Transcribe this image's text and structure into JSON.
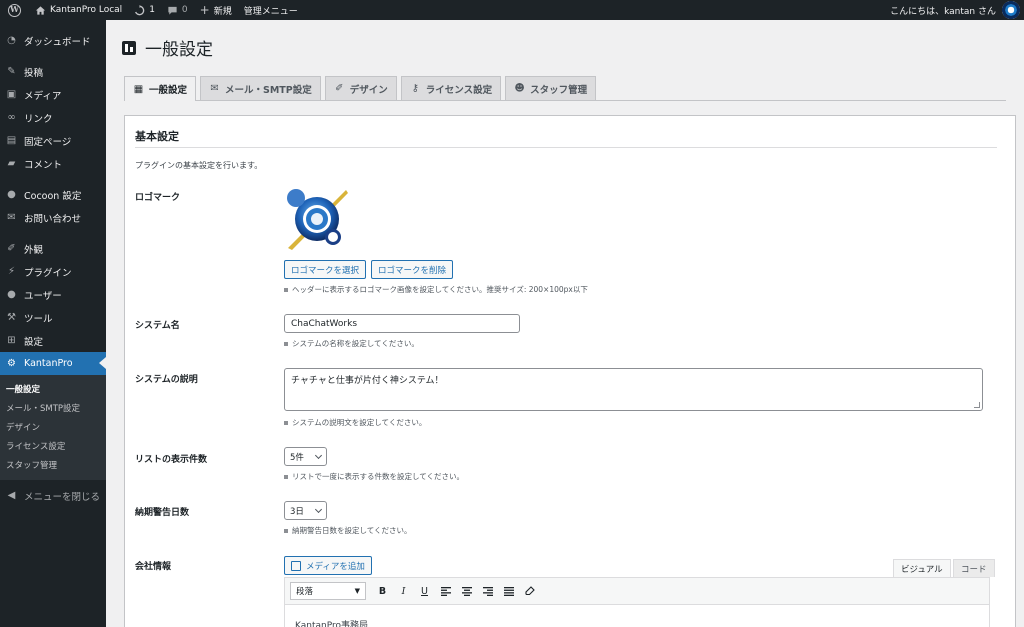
{
  "adminbar": {
    "site_name": "KantanPro Local",
    "updates_count": "1",
    "comments_count": "0",
    "new_label": "新規",
    "admin_menu_label": "管理メニュー",
    "greeting": "こんにちは、kantan さん"
  },
  "sidebar": {
    "items": [
      {
        "label": "ダッシュボード",
        "icon": "dashboard-icon"
      },
      {
        "label": "投稿",
        "icon": "pin-icon"
      },
      {
        "label": "メディア",
        "icon": "media-icon"
      },
      {
        "label": "リンク",
        "icon": "link-icon"
      },
      {
        "label": "固定ページ",
        "icon": "page-icon"
      },
      {
        "label": "コメント",
        "icon": "comment-icon"
      },
      {
        "label": "Cocoon 設定",
        "icon": "cocoon-icon"
      },
      {
        "label": "お問い合わせ",
        "icon": "mail-icon"
      },
      {
        "label": "外観",
        "icon": "brush-icon"
      },
      {
        "label": "プラグイン",
        "icon": "plugin-icon"
      },
      {
        "label": "ユーザー",
        "icon": "user-icon"
      },
      {
        "label": "ツール",
        "icon": "wrench-icon"
      },
      {
        "label": "設定",
        "icon": "settings-icon"
      },
      {
        "label": "KantanPro",
        "icon": "gear-icon"
      }
    ],
    "submenu": [
      "一般設定",
      "メール・SMTP設定",
      "デザイン",
      "ライセンス設定",
      "スタッフ管理"
    ],
    "collapse_label": "メニューを閉じる"
  },
  "page": {
    "title": "一般設定",
    "tabs": [
      {
        "label": "一般設定",
        "icon": "settings-icon"
      },
      {
        "label": "メール・SMTP設定",
        "icon": "mail-icon"
      },
      {
        "label": "デザイン",
        "icon": "brush-icon"
      },
      {
        "label": "ライセンス設定",
        "icon": "key-icon"
      },
      {
        "label": "スタッフ管理",
        "icon": "groups-icon"
      }
    ]
  },
  "panel": {
    "title": "基本設定",
    "description": "プラグインの基本設定を行います。",
    "logo": {
      "label": "ロゴマーク",
      "select_button": "ロゴマークを選択",
      "delete_button": "ロゴマークを削除",
      "help": "ヘッダーに表示するロゴマーク画像を設定してください。推奨サイズ: 200×100px以下"
    },
    "system_name": {
      "label": "システム名",
      "value": "ChaChatWorks",
      "help": "システムの名称を設定してください。"
    },
    "system_description": {
      "label": "システムの説明",
      "value": "チャチャと仕事が片付く神システム！",
      "help": "システムの説明文を設定してください。"
    },
    "list_count": {
      "label": "リストの表示件数",
      "value": "5件",
      "help": "リストで一度に表示する件数を設定してください。"
    },
    "deadline_days": {
      "label": "納期警告日数",
      "value": "3日",
      "help": "納期警告日数を設定してください。"
    },
    "company": {
      "label": "会社情報",
      "add_media": "メディアを追加",
      "tab_visual": "ビジュアル",
      "tab_code": "コード",
      "format_select": "段落",
      "content_preview": "KantanPro事務局"
    }
  },
  "colors": {
    "accent": "#2271b1",
    "sidebar_bg": "#1d2327"
  }
}
